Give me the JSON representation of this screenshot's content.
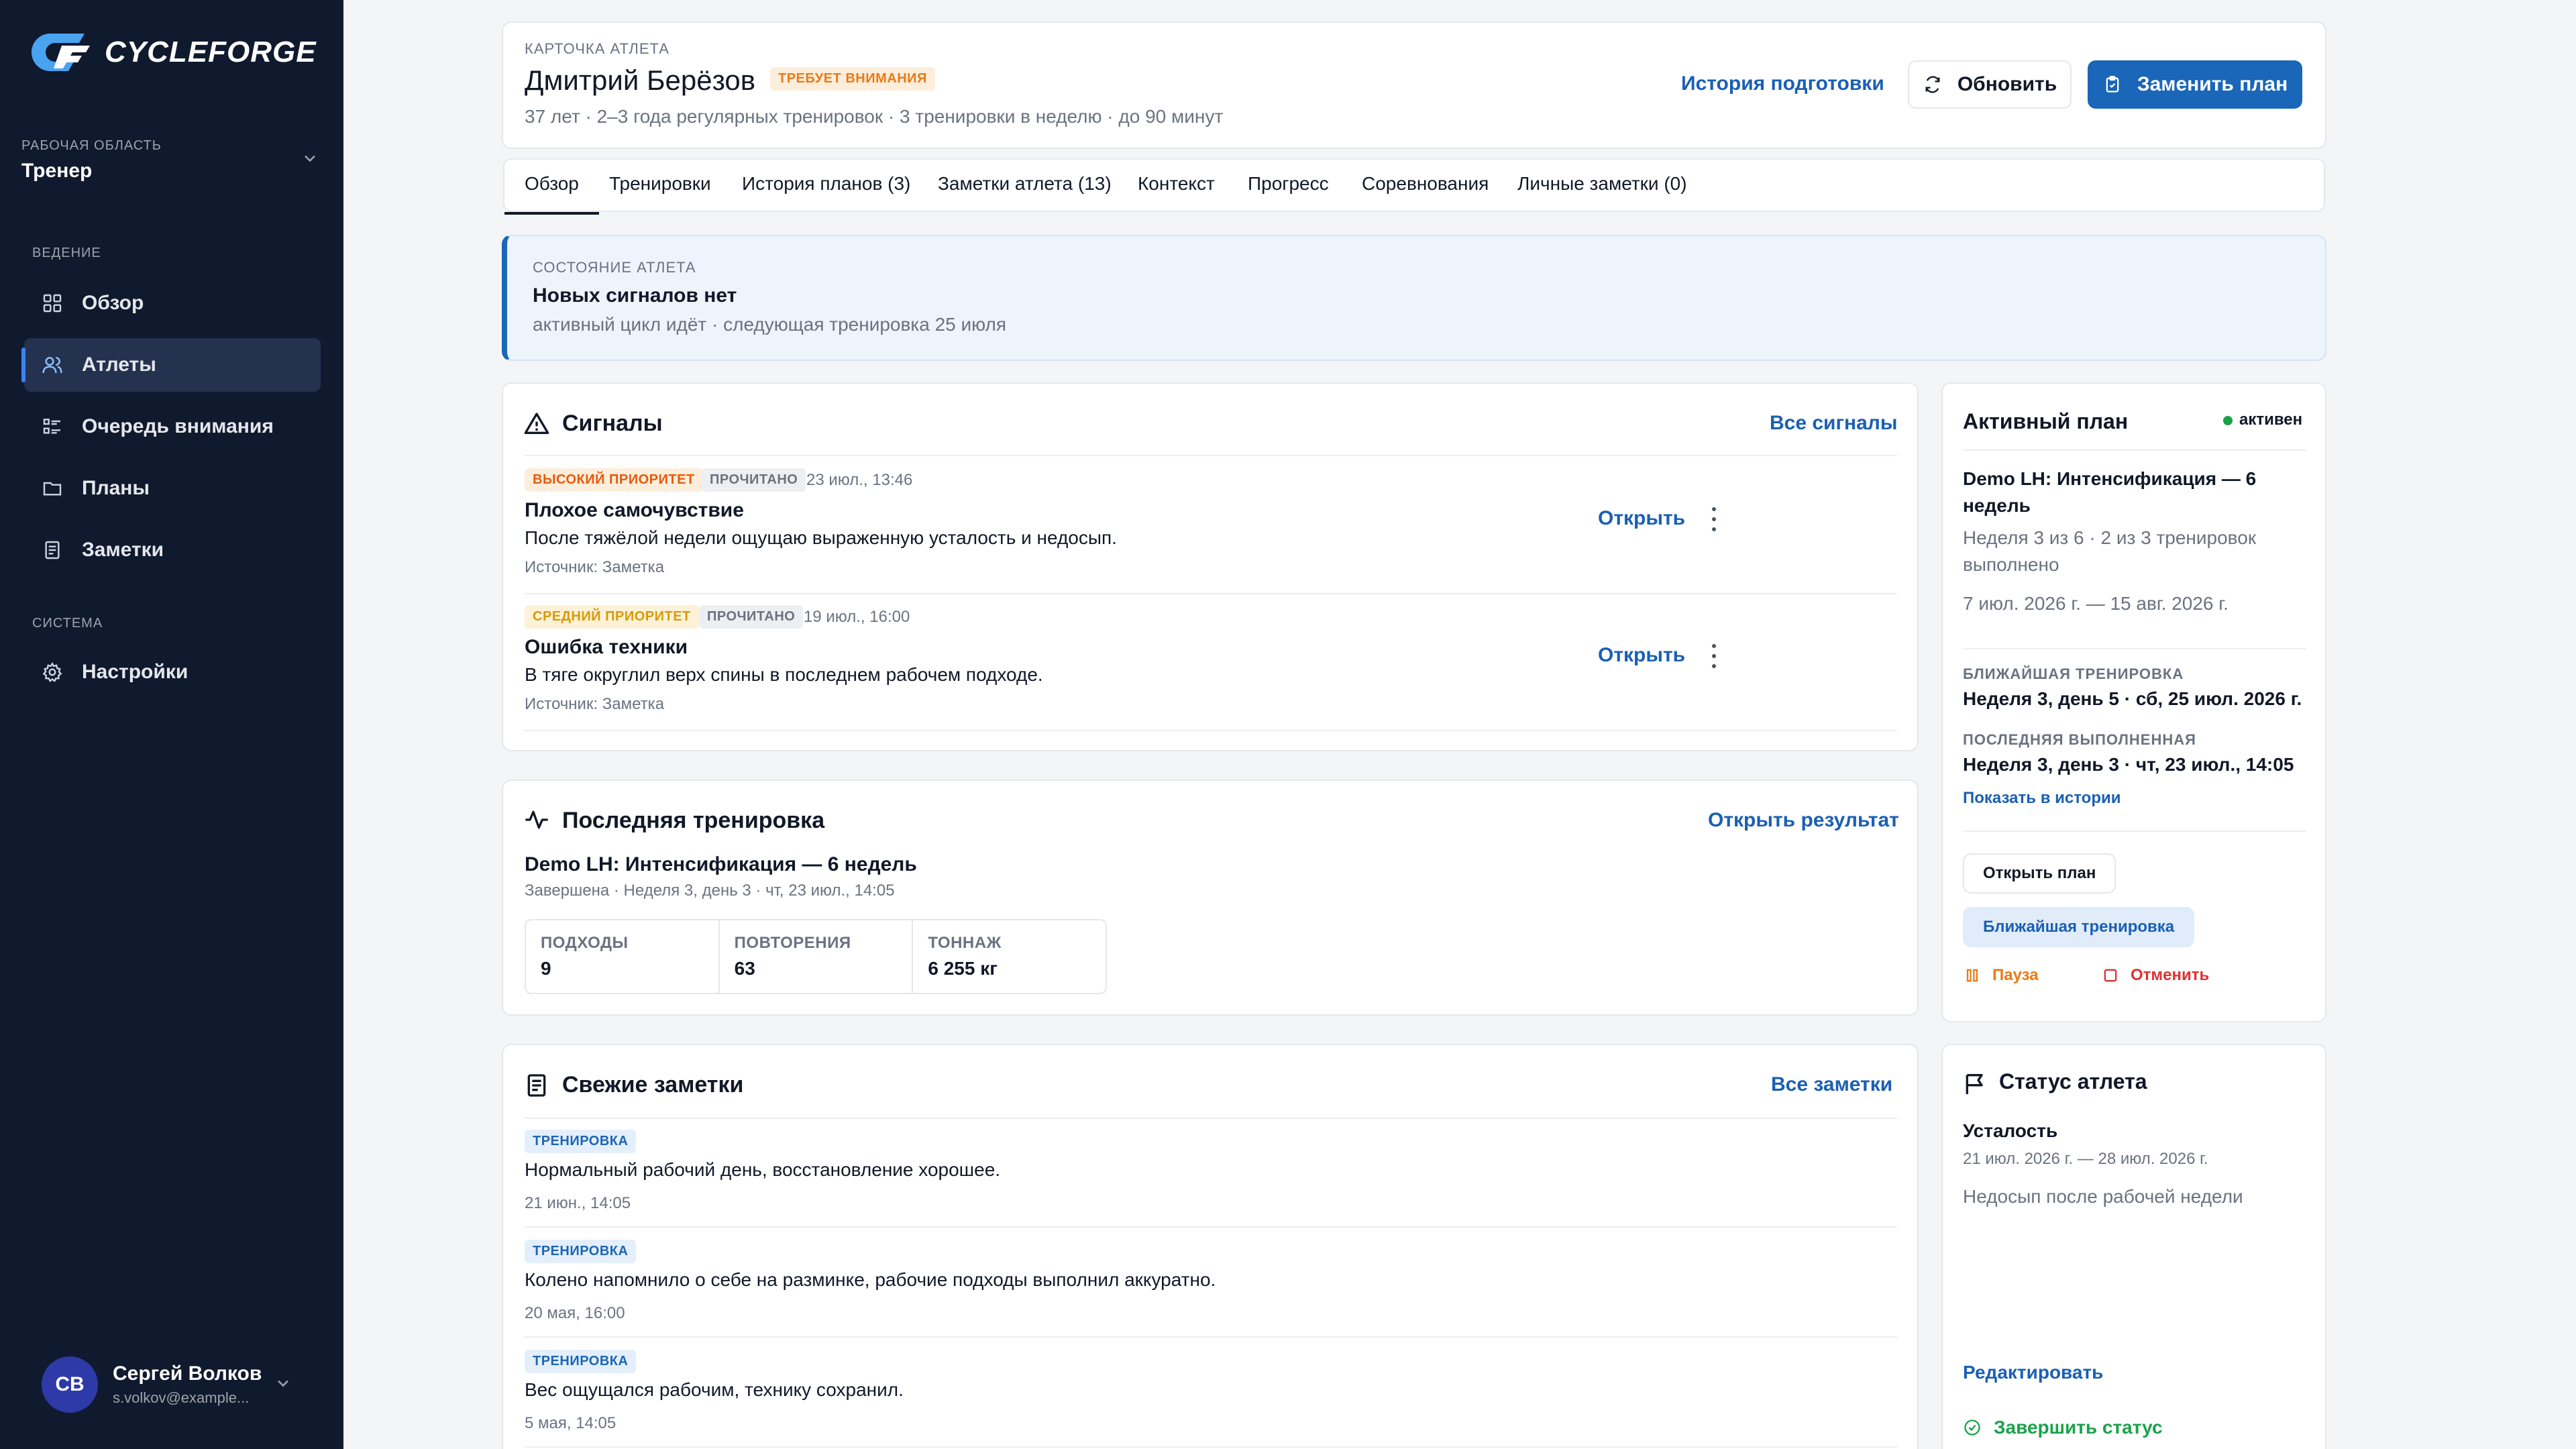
{
  "app": {
    "logo_text": "CYCLEFORGE",
    "colors": {
      "sidebar_bg": "#101a2e",
      "accent": "#1a66b8",
      "danger": "#e03131",
      "success": "#1aa34a",
      "warning": "#ea7a17"
    }
  },
  "sidebar": {
    "workspace_caption": "РАБОЧАЯ ОБЛАСТЬ",
    "workspace_value": "Тренер",
    "sections": [
      {
        "title": "ВЕДЕНИЕ",
        "items": [
          {
            "label": "Обзор",
            "icon": "grid-icon"
          },
          {
            "label": "Атлеты",
            "icon": "users-icon",
            "active": true
          },
          {
            "label": "Очередь внимания",
            "icon": "list-icon"
          },
          {
            "label": "Планы",
            "icon": "folder-icon"
          },
          {
            "label": "Заметки",
            "icon": "note-icon"
          }
        ]
      },
      {
        "title": "СИСТЕМА",
        "items": [
          {
            "label": "Настройки",
            "icon": "gear-icon"
          }
        ]
      }
    ],
    "user": {
      "initials": "СВ",
      "name": "Сергей Волков",
      "email": "s.volkov@example..."
    }
  },
  "header": {
    "caption": "КАРТОЧКА АТЛЕТА",
    "name": "Дмитрий Берёзов",
    "badge": "ТРЕБУЕТ ВНИМАНИЯ",
    "meta": "37 лет · 2–3 года регулярных тренировок · 3 тренировки в неделю · до 90 минут",
    "history_link": "История подготовки",
    "refresh_label": "Обновить",
    "replace_label": "Заменить план"
  },
  "tabs": [
    {
      "label": "Обзор",
      "active": true
    },
    {
      "label": "Тренировки"
    },
    {
      "label": "История планов (3)"
    },
    {
      "label": "Заметки атлета (13)"
    },
    {
      "label": "Контекст"
    },
    {
      "label": "Прогресс"
    },
    {
      "label": "Соревнования"
    },
    {
      "label": "Личные заметки (0)"
    }
  ],
  "state": {
    "caption": "СОСТОЯНИЕ АТЛЕТА",
    "title": "Новых сигналов нет",
    "subtitle": "активный цикл идёт · следующая тренировка 25 июля"
  },
  "signals": {
    "title": "Сигналы",
    "all_link": "Все сигналы",
    "items": [
      {
        "priority": "ВЫСОКИЙ ПРИОРИТЕТ",
        "priority_level": "high",
        "status": "ПРОЧИТАНО",
        "date": "23 июл., 13:46",
        "title": "Плохое самочувствие",
        "text": "После тяжёлой недели ощущаю выраженную усталость и недосып.",
        "source": "Источник: Заметка",
        "open_label": "Открыть"
      },
      {
        "priority": "СРЕДНИЙ ПРИОРИТЕТ",
        "priority_level": "mid",
        "status": "ПРОЧИТАНО",
        "date": "19 июл., 16:00",
        "title": "Ошибка техники",
        "text": "В тяге округлил верх спины в последнем рабочем подходе.",
        "source": "Источник: Заметка",
        "open_label": "Открыть"
      }
    ]
  },
  "last_workout": {
    "title": "Последняя тренировка",
    "open_link": "Открыть результат",
    "plan": "Demo LH: Интенсификация — 6 недель",
    "meta": "Завершена · Неделя 3, день 3 · чт, 23 июл., 14:05",
    "stats": [
      {
        "label": "ПОДХОДЫ",
        "value": "9"
      },
      {
        "label": "ПОВТОРЕНИЯ",
        "value": "63"
      },
      {
        "label": "ТОННАЖ",
        "value": "6 255 кг"
      }
    ]
  },
  "notes": {
    "title": "Свежие заметки",
    "all_link": "Все заметки",
    "items": [
      {
        "tag": "ТРЕНИРОВКА",
        "text": "Нормальный рабочий день, восстановление хорошее.",
        "date": "21 июн., 14:05"
      },
      {
        "tag": "ТРЕНИРОВКА",
        "text": "Колено напомнило о себе на разминке, рабочие подходы выполнил аккуратно.",
        "date": "20 мая, 16:00"
      },
      {
        "tag": "ТРЕНИРОВКА",
        "text": "Вес ощущался рабочим, технику сохранил.",
        "date": "5 мая, 14:05"
      }
    ]
  },
  "active_plan": {
    "title": "Активный план",
    "status": "активен",
    "plan_name_1": "Demo LH: Интенсификация — 6",
    "plan_name_2": "недель",
    "progress_1": "Неделя 3 из 6 · 2 из 3 тренировок",
    "progress_2": "выполнено",
    "dates": "7 июл. 2026 г. — 15 авг. 2026 г.",
    "next_caption": "БЛИЖАЙШАЯ ТРЕНИРОВКА",
    "next_value": "Неделя 3, день 5 · сб, 25 июл. 2026 г.",
    "last_caption": "ПОСЛЕДНЯЯ ВЫПОЛНЕННАЯ",
    "last_value": "Неделя 3, день 3 · чт, 23 июл., 14:05",
    "history_link": "Показать в истории",
    "open_plan": "Открыть план",
    "next_workout": "Ближайшая тренировка",
    "pause": "Пауза",
    "cancel": "Отменить"
  },
  "athlete_status": {
    "title": "Статус атлета",
    "status": "Усталость",
    "dates": "21 июл. 2026 г. — 28 июл. 2026 г.",
    "note": "Недосып после рабочей недели",
    "edit": "Редактировать",
    "finish": "Завершить статус"
  }
}
